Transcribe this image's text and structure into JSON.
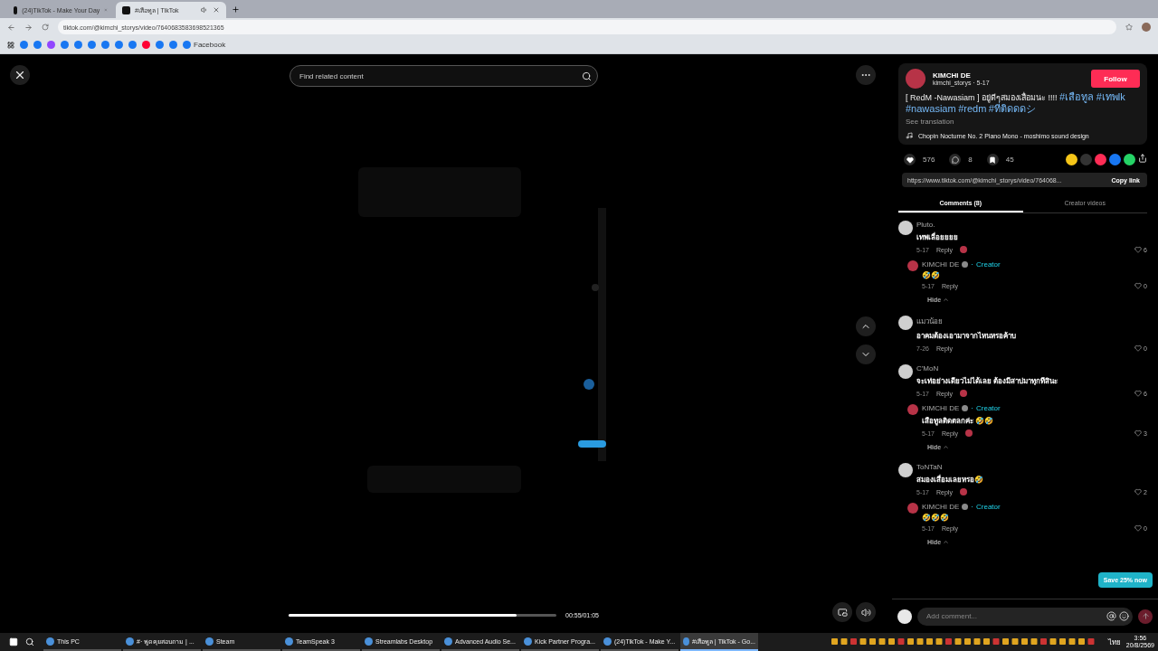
{
  "browser": {
    "tabs": [
      {
        "title": "(24)TikTok - Make Your Day",
        "selected": false,
        "audio": false
      },
      {
        "title": "#เสือทูล | TikTok",
        "selected": true,
        "audio": true
      }
    ],
    "url": "tiktok.com/@kimchi_storys/video/7640683583698521365",
    "bookmarks": [
      {
        "kind": "facebook"
      },
      {
        "kind": "facebook"
      },
      {
        "kind": "twitch"
      },
      {
        "kind": "facebook"
      },
      {
        "kind": "facebook"
      },
      {
        "kind": "facebook"
      },
      {
        "kind": "facebook"
      },
      {
        "kind": "facebook"
      },
      {
        "kind": "facebook"
      },
      {
        "kind": "youtube"
      },
      {
        "kind": "facebook"
      },
      {
        "kind": "facebook"
      },
      {
        "kind": "facebook",
        "label": "Facebook"
      }
    ]
  },
  "player": {
    "search": {
      "placeholder": "Find related content"
    },
    "progress": {
      "level": 0.85,
      "time": "00:55/01:05"
    }
  },
  "post": {
    "author": "KIMCHI DE",
    "handle": "kimchi_storys · 5-17",
    "follow": "Follow",
    "description": "[ RedM -Nawasiam ] อยู่ดีๆสมองเสื่อมนะ !!!!",
    "hashtags": [
      "#เสือทูล",
      "#เทพlk",
      "#nawasiam",
      "#redm",
      "#ที่ติดดดシ"
    ],
    "see_translation": "See translation",
    "music": "Chopin Nocturne No. 2 Piano Mono - moshimo sound design",
    "stats": {
      "likes": "576",
      "comments": "8",
      "saves": "45"
    },
    "share": [
      {
        "kind": "repost"
      },
      {
        "kind": "embed"
      },
      {
        "kind": "funnel"
      },
      {
        "kind": "facebook"
      },
      {
        "kind": "whatsapp"
      },
      {
        "kind": "more"
      }
    ],
    "link": "https://www.tiktok.com/@kimchi_storys/video/764068...",
    "copy": "Copy link"
  },
  "tabs": [
    {
      "label": "Comments (8)",
      "selected": true
    },
    {
      "label": "Creator videos",
      "selected": false
    }
  ],
  "comments": [
    {
      "user": "Pluto.",
      "text": "เทพเลื่อยยยย",
      "date": "5-17",
      "reply": "Reply",
      "liked_by_creator": true,
      "likes": "6",
      "hide": "Hide",
      "children": [
        {
          "user": "KIMCHI DE",
          "dot": "·",
          "creator": "Creator",
          "text": "🤣🤣",
          "date": "5-17",
          "reply": "Reply",
          "liked_by_creator": false,
          "likes": "0"
        }
      ]
    },
    {
      "user": "แมวน้อย",
      "text": "อาคมต้องเอามาจากไหนหรอค้าบ",
      "date": "7-26",
      "reply": "Reply",
      "liked_by_creator": false,
      "likes": "0"
    },
    {
      "user": "C'MoN",
      "text": "จะเท่อย่างเดียวไม่ได้เลย ต้องมีสาปมาทุกทีสินะ",
      "date": "5-17",
      "reply": "Reply",
      "liked_by_creator": true,
      "likes": "6",
      "hide": "Hide",
      "children": [
        {
          "user": "KIMCHI DE",
          "dot": "·",
          "creator": "Creator",
          "text": "เสือทูลติดตลกค่ะ 🤣🤣",
          "date": "5-17",
          "reply": "Reply",
          "liked_by_creator": true,
          "likes": "3"
        }
      ]
    },
    {
      "user": "ToNTaN",
      "text": "สมองเสื่อมเลยหรอ🤣",
      "date": "5-17",
      "reply": "Reply",
      "liked_by_creator": true,
      "likes": "2",
      "hide": "Hide",
      "children": [
        {
          "user": "KIMCHI DE",
          "dot": "·",
          "creator": "Creator",
          "text": "🤣🤣🤣",
          "date": "5-17",
          "reply": "Reply",
          "liked_by_creator": false,
          "likes": "0"
        }
      ]
    }
  ],
  "add_comment": {
    "placeholder": "Add comment..."
  },
  "promo": "Save 25% now",
  "taskbar": {
    "items": [
      {
        "label": "This PC",
        "selected": false
      },
      {
        "label": "#· พูดคุยสอบถาม | ...",
        "selected": false
      },
      {
        "label": "Steam",
        "selected": false
      },
      {
        "label": "TeamSpeak 3",
        "selected": false
      },
      {
        "label": "Streamlabs Desktop",
        "selected": false
      },
      {
        "label": "Advanced Audio Se...",
        "selected": false
      },
      {
        "label": "Kick Partner Progra...",
        "selected": false
      },
      {
        "label": "(24)TikTok - Make Y...",
        "selected": false
      },
      {
        "label": "#เสือทูล | TikTok - Go...",
        "selected": true
      }
    ],
    "language": "ไทย",
    "time": "3:56",
    "date": "20/8/2569"
  }
}
